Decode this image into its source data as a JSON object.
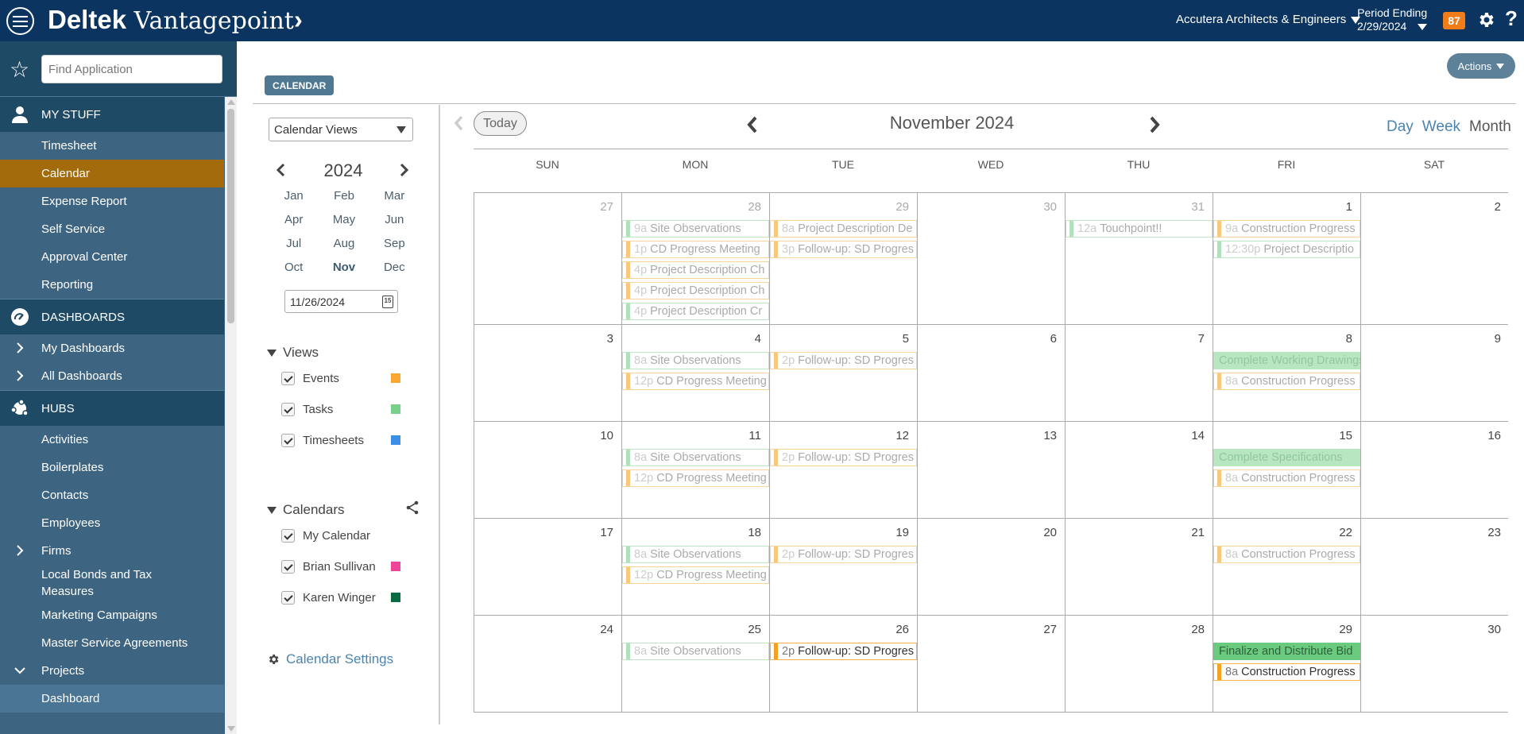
{
  "topbar": {
    "brand_bold": "Deltek",
    "brand_serif": " Vantagepoint",
    "brand_chevron": "›",
    "company": "Accutera Architects & Engineers",
    "period_label": "Period Ending",
    "period_date": "2/29/2024",
    "badge_count": "87",
    "help": "?"
  },
  "sidebar": {
    "search_placeholder": "Find Application",
    "sections": [
      {
        "title": "MY STUFF",
        "icon": "user-icon",
        "items": [
          {
            "label": "Timesheet"
          },
          {
            "label": "Calendar",
            "active": true
          },
          {
            "label": "Expense Report"
          },
          {
            "label": "Self Service"
          },
          {
            "label": "Approval Center"
          },
          {
            "label": "Reporting"
          }
        ]
      },
      {
        "title": "DASHBOARDS",
        "icon": "dashboard-gauge-icon",
        "items": [
          {
            "label": "My Dashboards",
            "expandable": true
          },
          {
            "label": "All Dashboards",
            "expandable": true
          }
        ]
      },
      {
        "title": "HUBS",
        "icon": "hubs-icon",
        "items": [
          {
            "label": "Activities"
          },
          {
            "label": "Boilerplates"
          },
          {
            "label": "Contacts"
          },
          {
            "label": "Employees"
          },
          {
            "label": "Firms",
            "expandable": true
          },
          {
            "label": "Local Bonds and Tax Measures"
          },
          {
            "label": "Marketing Campaigns"
          },
          {
            "label": "Master Service Agreements"
          },
          {
            "label": "Projects",
            "expanded": true
          },
          {
            "label": "Dashboard",
            "sub": true
          }
        ]
      }
    ]
  },
  "main": {
    "actions_label": "Actions",
    "tab_label": "CALENDAR",
    "left_panel": {
      "calendar_views_label": "Calendar Views",
      "year": "2024",
      "months": [
        "Jan",
        "Feb",
        "Mar",
        "Apr",
        "May",
        "Jun",
        "Jul",
        "Aug",
        "Sep",
        "Oct",
        "Nov",
        "Dec"
      ],
      "current_month": "Nov",
      "date_value": "11/26/2024",
      "date_icon_text": "15",
      "views_title": "Views",
      "views": [
        {
          "label": "Events",
          "checked": true,
          "color": "#f9a833"
        },
        {
          "label": "Tasks",
          "checked": true,
          "color": "#78d08a"
        },
        {
          "label": "Timesheets",
          "checked": true,
          "color": "#3d8fe6"
        }
      ],
      "calendars_title": "Calendars",
      "calendars": [
        {
          "label": "My Calendar",
          "checked": true,
          "color": null
        },
        {
          "label": "Brian Sullivan",
          "checked": true,
          "color": "#f0449a"
        },
        {
          "label": "Karen Winger",
          "checked": true,
          "color": "#0a6b43"
        }
      ],
      "settings_label": "Calendar Settings"
    },
    "calendar": {
      "today_label": "Today",
      "month_title": "November 2024",
      "views": [
        {
          "label": "Day",
          "current": false
        },
        {
          "label": "Week",
          "current": false
        },
        {
          "label": "Month",
          "current": true
        }
      ],
      "weekdays": [
        "SUN",
        "MON",
        "TUE",
        "WED",
        "THU",
        "FRI",
        "SAT"
      ],
      "weeks": [
        {
          "height": 166,
          "days": [
            {
              "num": "27",
              "other": true,
              "events": []
            },
            {
              "num": "28",
              "other": true,
              "events": [
                {
                  "time": "9a",
                  "title": "Site Observations",
                  "kind": "green"
                },
                {
                  "time": "1p",
                  "title": "CD Progress Meeting",
                  "kind": "orange"
                },
                {
                  "time": "4p",
                  "title": "Project Description Ch",
                  "kind": "orange"
                },
                {
                  "time": "4p",
                  "title": "Project Description Ch",
                  "kind": "orange"
                },
                {
                  "time": "4p",
                  "title": "Project Description Cr",
                  "kind": "green"
                }
              ]
            },
            {
              "num": "29",
              "other": true,
              "events": [
                {
                  "time": "8a",
                  "title": "Project Description De",
                  "kind": "orange"
                },
                {
                  "time": "3p",
                  "title": "Follow-up: SD Progres",
                  "kind": "orange"
                }
              ]
            },
            {
              "num": "30",
              "other": true,
              "events": []
            },
            {
              "num": "31",
              "other": true,
              "events": [
                {
                  "time": "12a",
                  "title": "Touchpoint!!",
                  "kind": "green"
                }
              ]
            },
            {
              "num": "1",
              "other": false,
              "events": [
                {
                  "time": "9a",
                  "title": "Construction Progress",
                  "kind": "orange"
                },
                {
                  "time": "12:30p",
                  "title": "Project Descriptio",
                  "kind": "green"
                }
              ]
            },
            {
              "num": "2",
              "other": false,
              "events": []
            }
          ]
        },
        {
          "height": 122,
          "days": [
            {
              "num": "3",
              "events": []
            },
            {
              "num": "4",
              "events": [
                {
                  "time": "8a",
                  "title": "Site Observations",
                  "kind": "green"
                },
                {
                  "time": "12p",
                  "title": "CD Progress Meeting",
                  "kind": "orange"
                }
              ]
            },
            {
              "num": "5",
              "events": [
                {
                  "time": "2p",
                  "title": "Follow-up: SD Progres",
                  "kind": "orange"
                }
              ]
            },
            {
              "num": "6",
              "events": []
            },
            {
              "num": "7",
              "events": []
            },
            {
              "num": "8",
              "events": [
                {
                  "time": "",
                  "title": "Complete Working Drawings",
                  "kind": "task"
                },
                {
                  "time": "8a",
                  "title": "Construction Progress",
                  "kind": "orange"
                }
              ]
            },
            {
              "num": "9",
              "events": []
            }
          ]
        },
        {
          "height": 122,
          "days": [
            {
              "num": "10",
              "events": []
            },
            {
              "num": "11",
              "events": [
                {
                  "time": "8a",
                  "title": "Site Observations",
                  "kind": "green"
                },
                {
                  "time": "12p",
                  "title": "CD Progress Meeting",
                  "kind": "orange"
                }
              ]
            },
            {
              "num": "12",
              "events": [
                {
                  "time": "2p",
                  "title": "Follow-up: SD Progres",
                  "kind": "orange"
                }
              ]
            },
            {
              "num": "13",
              "events": []
            },
            {
              "num": "14",
              "events": []
            },
            {
              "num": "15",
              "events": [
                {
                  "time": "",
                  "title": "Complete Specifications",
                  "kind": "task"
                },
                {
                  "time": "8a",
                  "title": "Construction Progress",
                  "kind": "orange"
                }
              ]
            },
            {
              "num": "16",
              "events": []
            }
          ]
        },
        {
          "height": 122,
          "days": [
            {
              "num": "17",
              "events": []
            },
            {
              "num": "18",
              "events": [
                {
                  "time": "8a",
                  "title": "Site Observations",
                  "kind": "green"
                },
                {
                  "time": "12p",
                  "title": "CD Progress Meeting",
                  "kind": "orange"
                }
              ]
            },
            {
              "num": "19",
              "events": [
                {
                  "time": "2p",
                  "title": "Follow-up: SD Progres",
                  "kind": "orange"
                }
              ]
            },
            {
              "num": "20",
              "events": []
            },
            {
              "num": "21",
              "events": []
            },
            {
              "num": "22",
              "events": [
                {
                  "time": "8a",
                  "title": "Construction Progress",
                  "kind": "orange"
                }
              ]
            },
            {
              "num": "23",
              "events": []
            }
          ]
        },
        {
          "height": 122,
          "days": [
            {
              "num": "24",
              "events": []
            },
            {
              "num": "25",
              "events": [
                {
                  "time": "8a",
                  "title": "Site Observations",
                  "kind": "green"
                }
              ]
            },
            {
              "num": "26",
              "events": [
                {
                  "time": "2p",
                  "title": "Follow-up: SD Progres",
                  "kind": "orange strong"
                }
              ]
            },
            {
              "num": "27",
              "events": []
            },
            {
              "num": "28",
              "events": []
            },
            {
              "num": "29",
              "events": [
                {
                  "time": "",
                  "title": "Finalize and Distribute Bid",
                  "kind": "task strong"
                },
                {
                  "time": "8a",
                  "title": "Construction Progress",
                  "kind": "orange strong"
                }
              ]
            },
            {
              "num": "30",
              "events": []
            }
          ]
        }
      ]
    }
  }
}
